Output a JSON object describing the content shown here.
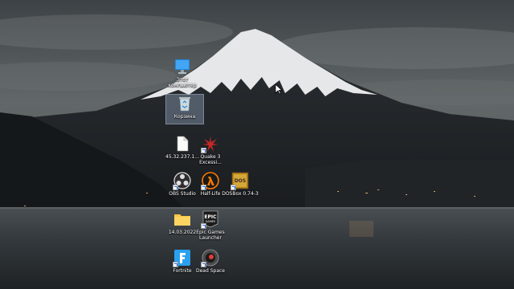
{
  "desktop": {
    "icons": [
      {
        "label": "Этот компьютер",
        "icon": "computer-icon",
        "shortcut": false
      },
      {
        "label": "Корзина",
        "icon": "recycle-bin-icon",
        "shortcut": false,
        "selected": true
      },
      {
        "label": "45.32.237.1...",
        "icon": "file-icon",
        "shortcut": false
      },
      {
        "label": "Quake 3 Excessi...",
        "icon": "quake3-icon",
        "shortcut": true
      },
      {
        "label": "OBS Studio",
        "icon": "obs-icon",
        "shortcut": true
      },
      {
        "label": "Half-Life",
        "icon": "half-life-icon",
        "shortcut": true
      },
      {
        "label": "DOSBox 0.74-3",
        "icon": "dosbox-icon",
        "shortcut": true
      },
      {
        "label": "14.03.2022",
        "icon": "folder-icon",
        "shortcut": false
      },
      {
        "label": "Epic Games Launcher",
        "icon": "epic-games-icon",
        "shortcut": true
      },
      {
        "label": "Fortnite",
        "icon": "fortnite-icon",
        "shortcut": true
      },
      {
        "label": "Dead Space",
        "icon": "dead-space-icon",
        "shortcut": true
      }
    ]
  },
  "epic_logo_text": {
    "line1": "EPIC",
    "line2": "GAMES"
  },
  "dosbox_logo_text": "DOS",
  "colors": {
    "sky": "#5b6163",
    "mountain": "#23272a",
    "snow": "#e6e7e8",
    "water": "#2b2f33",
    "selection": "#aabedc"
  }
}
